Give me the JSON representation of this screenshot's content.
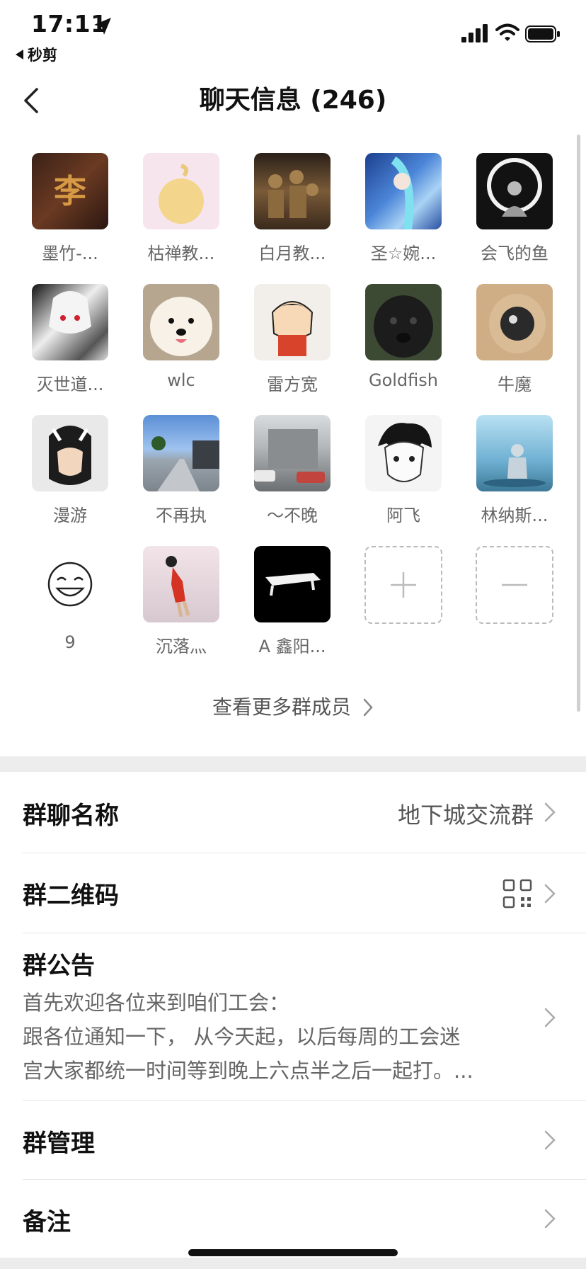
{
  "status_bar": {
    "time": "17:11",
    "back_app": "秒剪"
  },
  "nav": {
    "title": "聊天信息 (246)"
  },
  "members": [
    {
      "name": "墨竹-..."
    },
    {
      "name": "枯禅教..."
    },
    {
      "name": "白月教..."
    },
    {
      "name": "圣☆婉..."
    },
    {
      "name": "会飞的鱼"
    },
    {
      "name": "灭世道..."
    },
    {
      "name": "wlc"
    },
    {
      "name": "雷方宽"
    },
    {
      "name": "Goldfish"
    },
    {
      "name": "牛魔"
    },
    {
      "name": "漫游"
    },
    {
      "name": "不再执"
    },
    {
      "name": "～不晚"
    },
    {
      "name": "阿飞"
    },
    {
      "name": "林纳斯..."
    },
    {
      "name": "9"
    },
    {
      "name": "沉落灬"
    },
    {
      "name": "A 鑫阳..."
    }
  ],
  "see_more": "查看更多群成员",
  "settings": {
    "group_name_label": "群聊名称",
    "group_name_value": "地下城交流群",
    "qr_label": "群二维码",
    "notice_label": "群公告",
    "notice_line1": "首先欢迎各位来到咱们工会：",
    "notice_line2": "跟各位通知一下， 从今天起，以后每周的工会迷",
    "notice_line3": "宫大家都统一时间等到晚上六点半之后一起打。...",
    "manage_label": "群管理",
    "remark_label": "备注"
  },
  "colors": {
    "section_gap": "#ededed",
    "secondary_text": "#666666"
  }
}
